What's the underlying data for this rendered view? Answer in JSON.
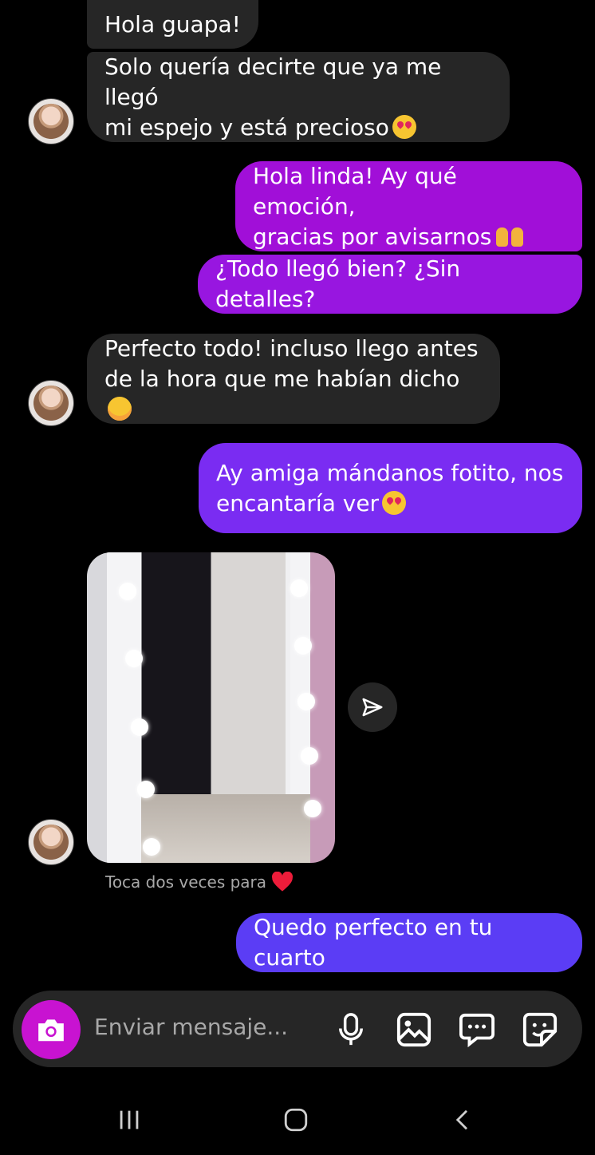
{
  "messages": [
    {
      "text": "Hola guapa!"
    },
    {
      "line1": "Solo quería decirte que ya me llegó",
      "line2": "mi espejo y está precioso"
    },
    {
      "line1": "Hola linda! Ay qué emoción,",
      "line2": "gracias por avisarnos"
    },
    {
      "text": "¿Todo llegó bien? ¿Sin detalles?"
    },
    {
      "line1": "Perfecto todo! incluso llego antes",
      "line2": "de la hora que me habían dicho"
    },
    {
      "line1": "Ay amiga mándanos fotito, nos",
      "line2": "encantaría ver"
    },
    {
      "text": "Quedo perfecto en tu cuarto"
    }
  ],
  "photo_caption": "Toca dos veces para",
  "composer": {
    "placeholder": "Enviar mensaje..."
  },
  "colors": {
    "incoming_bubble": "#262626",
    "outgoing_gradient": [
      "#a10fd8",
      "#7a2cf2",
      "#5b3df5"
    ],
    "camera_button": "#c813d1",
    "heart": "#ed1c3a"
  },
  "icons": [
    "camera-icon",
    "microphone-icon",
    "gallery-icon",
    "chat-bubble-icon",
    "sticker-icon",
    "send-icon",
    "heart-icon",
    "recents-nav-icon",
    "home-nav-icon",
    "back-nav-icon"
  ]
}
